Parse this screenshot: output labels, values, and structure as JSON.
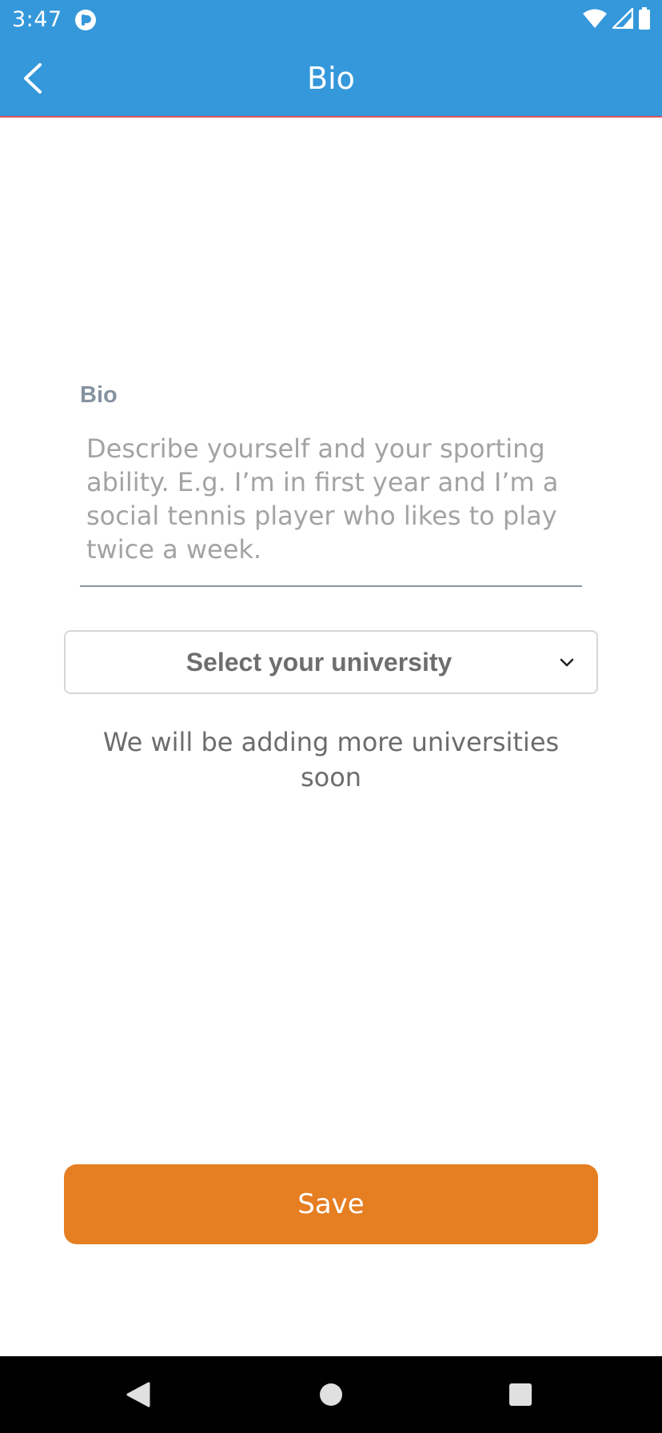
{
  "status_bar": {
    "time": "3:47",
    "app_icon": "pocket-casts-like-icon",
    "icons": [
      "wifi-icon",
      "cell-signal-icon",
      "battery-icon"
    ]
  },
  "app_bar": {
    "title": "Bio",
    "back_icon": "chevron-left-icon"
  },
  "bio": {
    "label": "Bio",
    "value": "",
    "placeholder": "Describe yourself and your sporting ability. E.g. I’m in first year and I’m a social tennis player who likes to play twice a week."
  },
  "university_select": {
    "selected": "Select your university",
    "icon": "chevron-down-icon"
  },
  "note": "We will be adding more universities soon",
  "save_button": {
    "label": "Save"
  },
  "nav_bar": {
    "icons": [
      "back-triangle-icon",
      "home-circle-icon",
      "recents-square-icon"
    ]
  },
  "colors": {
    "primary": "#3498db",
    "accent": "#e67e22",
    "label": "#8592a0"
  }
}
